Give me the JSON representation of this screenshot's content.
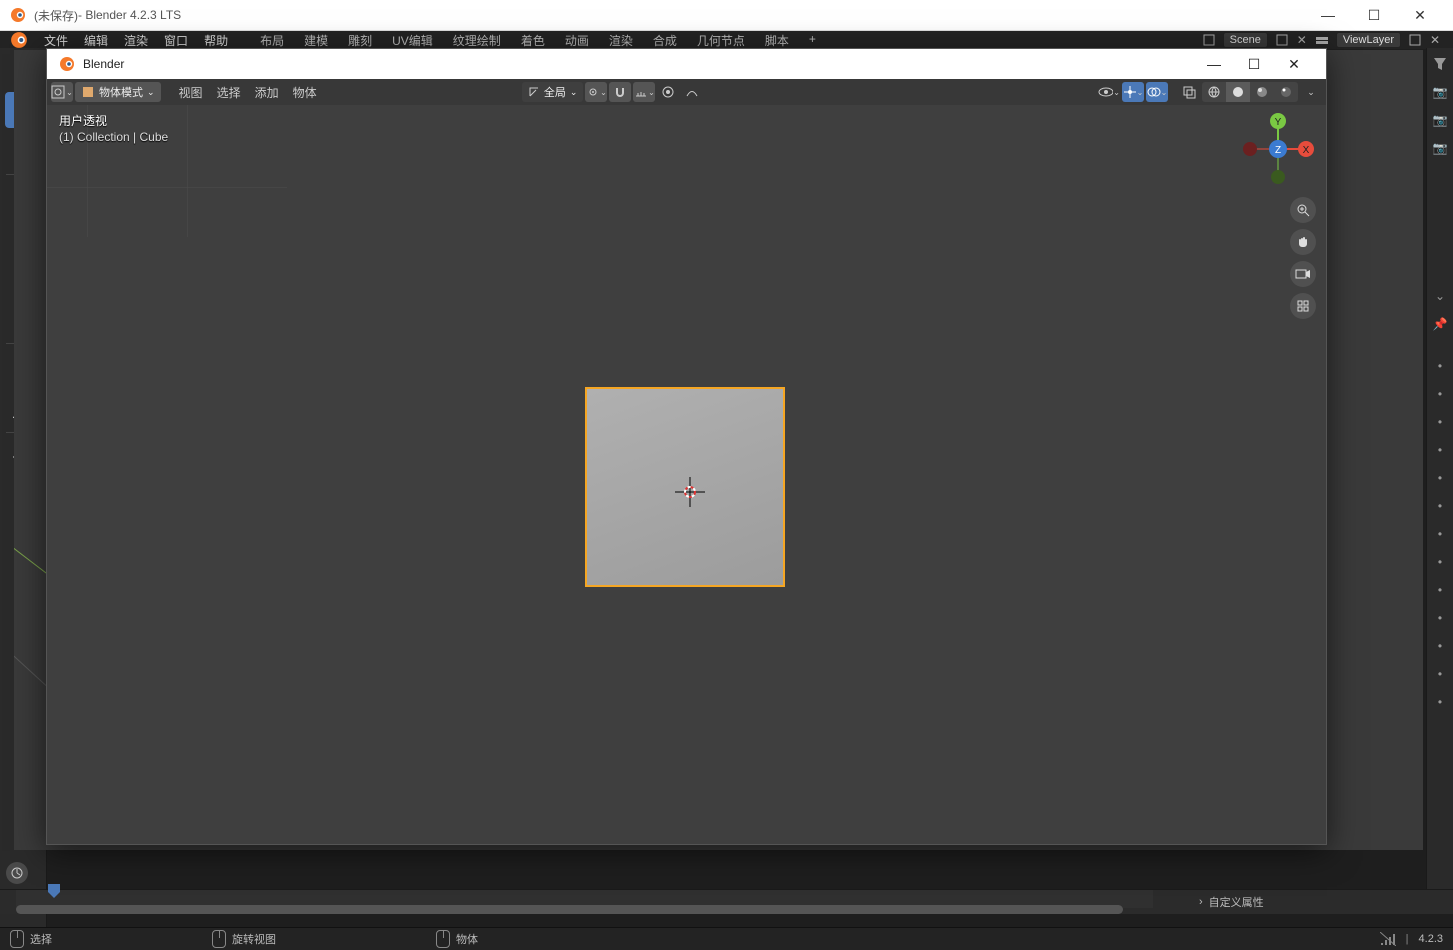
{
  "outer": {
    "title_unsaved": "(未保存)",
    "title_app": " - Blender 4.2.3 LTS"
  },
  "menu": {
    "items": [
      "文件",
      "编辑",
      "渲染",
      "窗口",
      "帮助"
    ],
    "workspaces": [
      "布局",
      "建模",
      "雕刻",
      "UV编辑",
      "纹理绘制",
      "着色",
      "动画",
      "渲染",
      "合成",
      "几何节点",
      "脚本",
      "+"
    ],
    "scene_field": "Scene",
    "viewlayer_field": "ViewLayer"
  },
  "inner": {
    "title": "Blender"
  },
  "vp_header": {
    "mode": "物体模式",
    "menus": [
      "视图",
      "选择",
      "添加",
      "物体"
    ],
    "orientation": "全局"
  },
  "overlay": {
    "line1": "用户透视",
    "line2": "(1) Collection | Cube"
  },
  "gizmo": {
    "x": "X",
    "y": "Y",
    "z": "Z"
  },
  "properties_panel": {
    "custom": "自定义属性"
  },
  "status": {
    "select": "选择",
    "rotate": "旋转视图",
    "object": "物体",
    "version": "4.2.3"
  }
}
